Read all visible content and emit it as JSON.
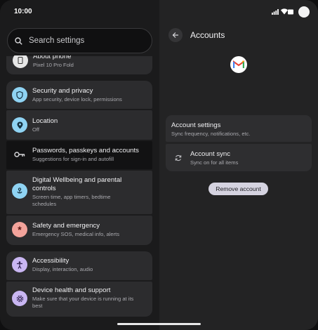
{
  "status": {
    "time": "10:00"
  },
  "search": {
    "placeholder": "Search settings"
  },
  "settings_items": [
    {
      "title": "About phone",
      "subtitle": "Pixel 10 Pro Fold"
    },
    {
      "title": "Security and privacy",
      "subtitle": "App security, device lock, permissions"
    },
    {
      "title": "Location",
      "subtitle": "Off"
    },
    {
      "title": "Passwords, passkeys and accounts",
      "subtitle": "Suggestions for sign-in and autofill"
    },
    {
      "title_line1": "Digital Wellbeing and parental",
      "title_line2": "controls",
      "subtitle_line1": "Screen time, app timers, bedtime",
      "subtitle_line2": "schedules"
    },
    {
      "title": "Safety and emergency",
      "subtitle": "Emergency SOS, medical info, alerts"
    },
    {
      "title": "Accessibility",
      "subtitle": "Display, interaction, audio"
    },
    {
      "title": "Device health and support",
      "subtitle_line1": "Make sure that your device is running at its",
      "subtitle_line2": "best"
    }
  ],
  "accounts": {
    "title": "Accounts",
    "account_settings": {
      "title": "Account settings",
      "subtitle": "Sync frequency, notifications, etc."
    },
    "account_sync": {
      "title": "Account sync",
      "subtitle": "Sync on for all items"
    },
    "remove_label": "Remove account"
  },
  "colors": {
    "security_icon_bg": "#8fd3f3",
    "location_icon_bg": "#8fd3f3",
    "wellbeing_icon_bg": "#8fd3f3",
    "safety_icon_bg": "#f3a39b",
    "accessibility_icon_bg": "#c9b6f2",
    "device_health_icon_bg": "#c9b6f2"
  }
}
